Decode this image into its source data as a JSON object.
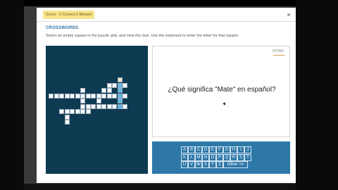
{
  "header": {
    "score_text": "Score : 0 Correct 0 Missed",
    "close_label": "×"
  },
  "activity": {
    "title": "CROSSWORDS",
    "instructions": "Select an empty square in the puzzle grid, and view the clue. Use the keyboard to enter the letter for that square."
  },
  "clue": {
    "direction": "DOWN",
    "text": "¿Qué significa \"Mate\" en español?"
  },
  "keyboard": {
    "keys": [
      "A",
      "B",
      "C",
      "D",
      "E",
      "F",
      "G",
      "H",
      "I",
      "J",
      "K",
      "L",
      "M",
      "N",
      "O",
      "P",
      "Q",
      "R",
      "S",
      "T",
      "U",
      "V",
      "W",
      "X",
      "Y",
      "Z",
      "Other >>"
    ]
  },
  "colors": {
    "grid_bg": "#0e3a52",
    "highlight": "#58b9ea",
    "active": "#f3eec0",
    "keyboard_bg": "#2e78a8",
    "title": "#2e6da4"
  }
}
